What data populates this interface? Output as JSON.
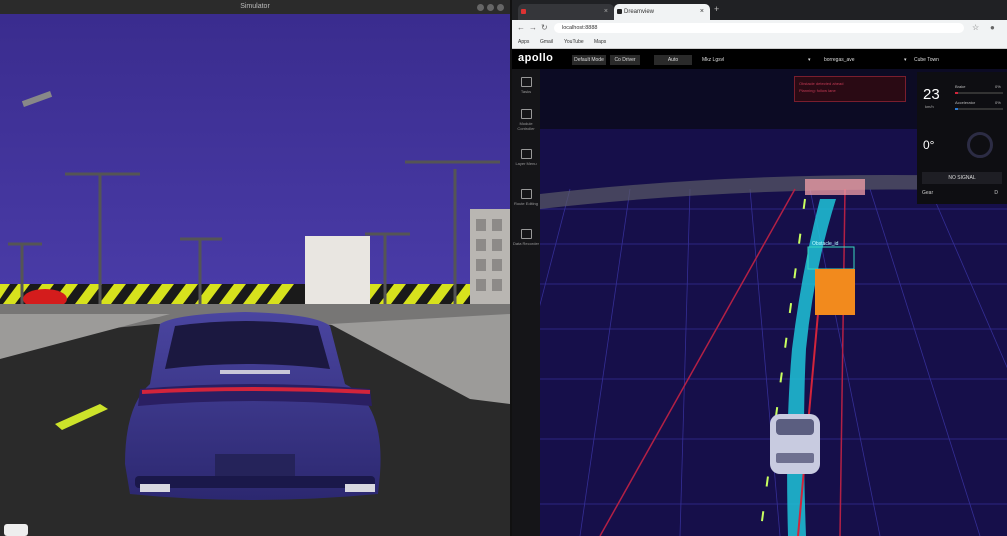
{
  "sim": {
    "window_title": "Simulator"
  },
  "browser": {
    "tabs": [
      {
        "label": "",
        "active": false
      },
      {
        "label": "Dreamview",
        "active": true
      }
    ],
    "url": "localhost:8888",
    "bookmarks": [
      "Apps",
      "Gmail",
      "YouTube",
      "Maps"
    ]
  },
  "dreamview": {
    "logo": "apollo",
    "header": {
      "setup_mode": "Default Mode",
      "vehicle": "Co Driver",
      "drive_mode": "Auto",
      "map_label": "Mkz Lgsvl",
      "map": "borregas_ave",
      "camera": "Cube Town"
    },
    "side_menu": [
      {
        "label": "Tasks",
        "icon": "tasks-icon"
      },
      {
        "label": "Module Controller",
        "icon": "module-controller-icon"
      },
      {
        "label": "Layer Menu",
        "icon": "layer-menu-icon"
      },
      {
        "label": "Route Editing",
        "icon": "route-editing-icon"
      },
      {
        "label": "Data Recorder",
        "icon": "data-recorder-icon"
      }
    ],
    "alert_lines": [
      "Obstacle detected ahead",
      "Planning: follow lane"
    ],
    "obstacle_label": "Obstacle_id",
    "status": {
      "speed": "23",
      "speed_unit": "km/h",
      "brake_label": "Brake",
      "brake_pct": "0%",
      "accel_label": "Accelerator",
      "accel_pct": "0%",
      "steering": "0°",
      "signal": "NO SIGNAL",
      "gear_label": "Gear",
      "gear_value": "D"
    }
  },
  "colors": {
    "sky": "#3f2f93",
    "trajectory": "#1fc3d8",
    "obstacle": "#f28a1d",
    "lane_red": "#b32045"
  }
}
